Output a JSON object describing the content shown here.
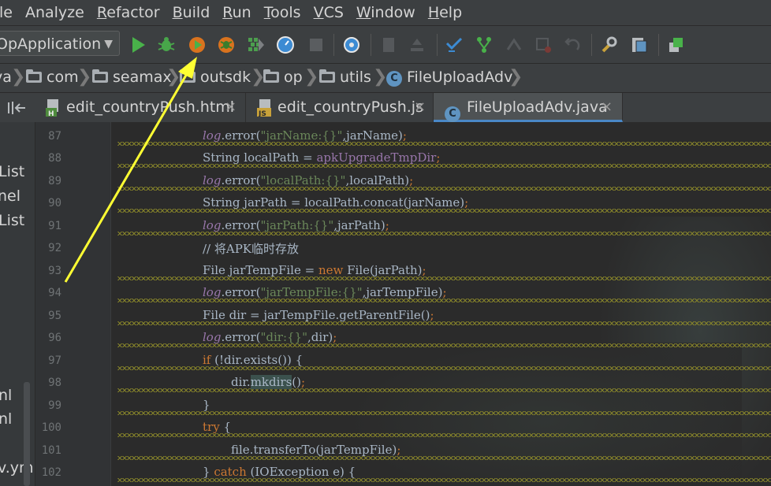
{
  "menu": [
    "le",
    "Analyze",
    "Refactor",
    "Build",
    "Run",
    "Tools",
    "VCS",
    "Window",
    "Help"
  ],
  "run_config": {
    "label": "OpApplication"
  },
  "toolbar": {
    "icons": [
      "run-icon",
      "debug-icon",
      "run-with-coverage-icon",
      "profile-icon",
      "build-icon",
      "stopwatch-icon",
      "stop-icon",
      "search-everywhere-icon",
      "vcs-update-icon",
      "vcs-commit-icon",
      "vcs-branch-icon",
      "vcs-push-icon",
      "vcs-history-icon",
      "revert-icon",
      "settings-wrench-icon",
      "project-structure-icon",
      "sdk-manager-icon"
    ]
  },
  "breadcrumbs": {
    "items": [
      "va",
      "com",
      "seamax",
      "outsdk",
      "op",
      "utils",
      "FileUploadAdv"
    ],
    "class_badge": "C"
  },
  "tabs": [
    {
      "label": "edit_countryPush.html",
      "badge": "H",
      "active": false
    },
    {
      "label": "edit_countryPush.js",
      "badge": "JS",
      "active": false
    },
    {
      "label": "FileUploadAdv.java",
      "badge": "C",
      "active": true
    }
  ],
  "close_glyph": "×",
  "project_panel": {
    "items": [
      "List",
      "nel",
      "List",
      "nl",
      "nl",
      "v.yml"
    ]
  },
  "gutter": {
    "lines": [
      "87",
      "88",
      "89",
      "90",
      "91",
      "92",
      "93",
      "94",
      "95",
      "96",
      "97",
      "98",
      "99",
      "100",
      "101",
      "102"
    ]
  },
  "code": {
    "l87": [
      "log",
      ".error(",
      "\"jarName:{}\"",
      ",jarName)",
      ";"
    ],
    "l88": [
      "String localPath = ",
      "apkUpgradeTmpDir",
      ";"
    ],
    "l89": [
      "log",
      ".error(",
      "\"localPath:{}\"",
      ",localPath)",
      ";"
    ],
    "l90": [
      "String jarPath = localPath.concat(jarName)",
      ";"
    ],
    "l91": [
      "log",
      ".error(",
      "\"jarPath:{}\"",
      ",jarPath)",
      ";"
    ],
    "l92": [
      "// 将APK临时存放"
    ],
    "l93": [
      "File jarTempFile = ",
      "new ",
      "File(jarPath)",
      ";"
    ],
    "l94": [
      "log",
      ".error(",
      "\"jarTempFile:{}\"",
      ",jarTempFile)",
      ";"
    ],
    "l95": [
      "File dir = jarTempFile.getParentFile()",
      ";"
    ],
    "l96": [
      "log",
      ".error(",
      "\"dir:{}\"",
      ",dir)",
      ";"
    ],
    "l97": [
      "if ",
      "(!dir.exists()) {"
    ],
    "l98": [
      "dir.",
      "mkdirs",
      "()",
      ";"
    ],
    "l99": [
      "}"
    ],
    "l100": [
      "try ",
      "{"
    ],
    "l101": [
      "file.transferTo(jarTempFile)",
      ";"
    ],
    "l102": [
      "} ",
      "catch ",
      "(IOException e) {"
    ]
  },
  "colors": {
    "annotation_arrow": "#ffff33",
    "keyword": "#cc7832",
    "string": "#6a8759",
    "comment": "#629755",
    "field": "#9876aa",
    "accent": "#4a88c7"
  }
}
